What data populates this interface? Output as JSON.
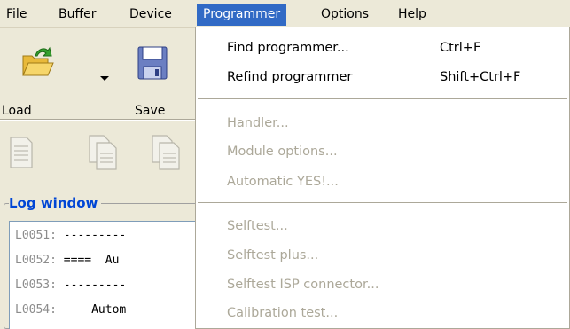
{
  "menubar": {
    "items": [
      "File",
      "Buffer",
      "Device",
      "Programmer",
      "Options",
      "Help"
    ],
    "active": "Programmer"
  },
  "toolbar": {
    "load_label": "Load",
    "save_label": "Save"
  },
  "log_window": {
    "title": "Log window",
    "lines": [
      {
        "num": "L0051:",
        "text": " ---------"
      },
      {
        "num": "L0052:",
        "text": " ====  Au"
      },
      {
        "num": "L0053:",
        "text": " ---------"
      },
      {
        "num": "L0054:",
        "text": "     Autom"
      }
    ]
  },
  "programmer_menu": {
    "items": [
      {
        "label": "Find programmer...",
        "shortcut": "Ctrl+F",
        "enabled": true
      },
      {
        "label": "Refind programmer",
        "shortcut": "Shift+Ctrl+F",
        "enabled": true
      },
      {
        "label": "Handler...",
        "shortcut": "",
        "enabled": false
      },
      {
        "label": "Module options...",
        "shortcut": "",
        "enabled": false
      },
      {
        "label": "Automatic YES!...",
        "shortcut": "",
        "enabled": false
      },
      {
        "label": "Selftest...",
        "shortcut": "",
        "enabled": false
      },
      {
        "label": "Selftest plus...",
        "shortcut": "",
        "enabled": false
      },
      {
        "label": "Selftest ISP connector...",
        "shortcut": "",
        "enabled": false
      },
      {
        "label": "Calibration test...",
        "shortcut": "",
        "enabled": false
      }
    ]
  },
  "colors": {
    "menu_highlight": "#316ac5",
    "disabled_text": "#aca899",
    "log_title": "#0046d5"
  }
}
